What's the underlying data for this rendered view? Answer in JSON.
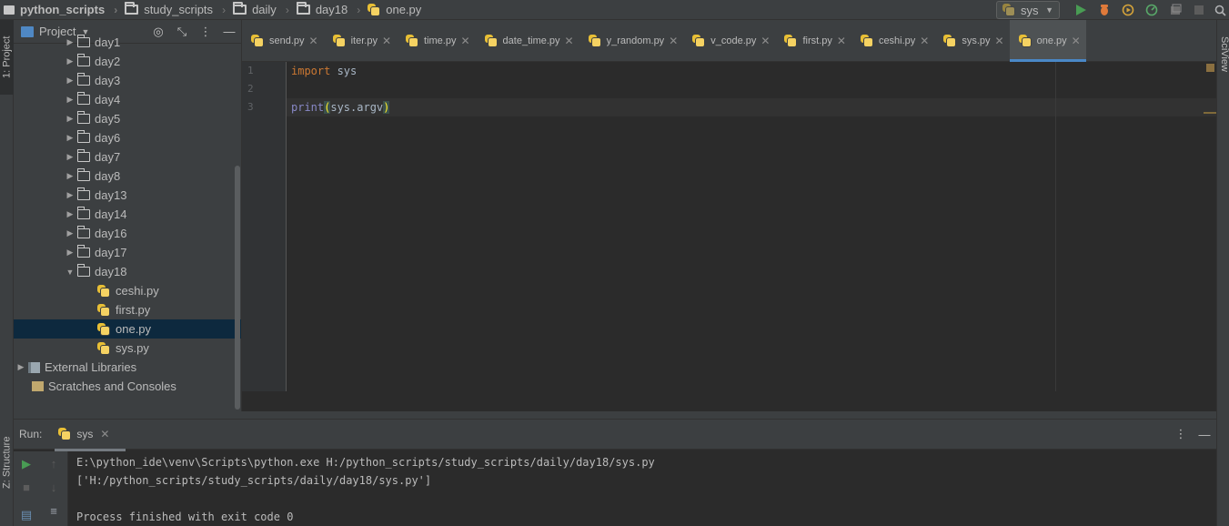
{
  "breadcrumb": {
    "items": [
      "python_scripts",
      "study_scripts",
      "daily",
      "day18",
      "one.py"
    ]
  },
  "toolbar": {
    "run_config": "sys",
    "icons": [
      "run-icon",
      "debug-icon",
      "coverage-icon",
      "profile-icon",
      "concurrency-icon",
      "stop-icon",
      "search-icon"
    ]
  },
  "left_strip": {
    "project_label": "1: Project",
    "structure_label": "Z: Structure"
  },
  "right_strip": {
    "sciview_label": "SciView"
  },
  "project_panel": {
    "title": "Project",
    "tree": [
      {
        "label": "day1",
        "type": "folder",
        "expanded": false,
        "depth": 1
      },
      {
        "label": "day2",
        "type": "folder",
        "expanded": false,
        "depth": 1
      },
      {
        "label": "day3",
        "type": "folder",
        "expanded": false,
        "depth": 1
      },
      {
        "label": "day4",
        "type": "folder",
        "expanded": false,
        "depth": 1
      },
      {
        "label": "day5",
        "type": "folder",
        "expanded": false,
        "depth": 1
      },
      {
        "label": "day6",
        "type": "folder",
        "expanded": false,
        "depth": 1
      },
      {
        "label": "day7",
        "type": "folder",
        "expanded": false,
        "depth": 1
      },
      {
        "label": "day8",
        "type": "folder",
        "expanded": false,
        "depth": 1
      },
      {
        "label": "day13",
        "type": "folder",
        "expanded": false,
        "depth": 1
      },
      {
        "label": "day14",
        "type": "folder",
        "expanded": false,
        "depth": 1
      },
      {
        "label": "day16",
        "type": "folder",
        "expanded": false,
        "depth": 1
      },
      {
        "label": "day17",
        "type": "folder",
        "expanded": false,
        "depth": 1
      },
      {
        "label": "day18",
        "type": "folder",
        "expanded": true,
        "depth": 1
      },
      {
        "label": "ceshi.py",
        "type": "py",
        "depth": 2
      },
      {
        "label": "first.py",
        "type": "py",
        "depth": 2
      },
      {
        "label": "one.py",
        "type": "py",
        "depth": 2,
        "selected": true
      },
      {
        "label": "sys.py",
        "type": "py",
        "depth": 2
      },
      {
        "label": "External Libraries",
        "type": "lib",
        "expanded": false,
        "depth": 0
      },
      {
        "label": "Scratches and Consoles",
        "type": "scratch",
        "depth": 0
      }
    ]
  },
  "tabs": [
    {
      "label": "send.py"
    },
    {
      "label": "iter.py"
    },
    {
      "label": "time.py"
    },
    {
      "label": "date_time.py"
    },
    {
      "label": "y_random.py"
    },
    {
      "label": "v_code.py"
    },
    {
      "label": "first.py"
    },
    {
      "label": "ceshi.py"
    },
    {
      "label": "sys.py"
    },
    {
      "label": "one.py",
      "active": true
    }
  ],
  "editor": {
    "line_numbers": [
      "1",
      "2",
      "3"
    ],
    "lines": [
      {
        "kw": "import",
        "rest": " sys"
      },
      {
        "kw": "",
        "rest": ""
      },
      {
        "fn": "print",
        "open": "(",
        "args": "sys.argv",
        "close": ")"
      }
    ]
  },
  "run_panel": {
    "label": "Run:",
    "tab": "sys",
    "output": [
      "E:\\python_ide\\venv\\Scripts\\python.exe H:/python_scripts/study_scripts/daily/day18/sys.py",
      "['H:/python_scripts/study_scripts/daily/day18/sys.py']",
      "",
      "Process finished with exit code 0"
    ]
  }
}
